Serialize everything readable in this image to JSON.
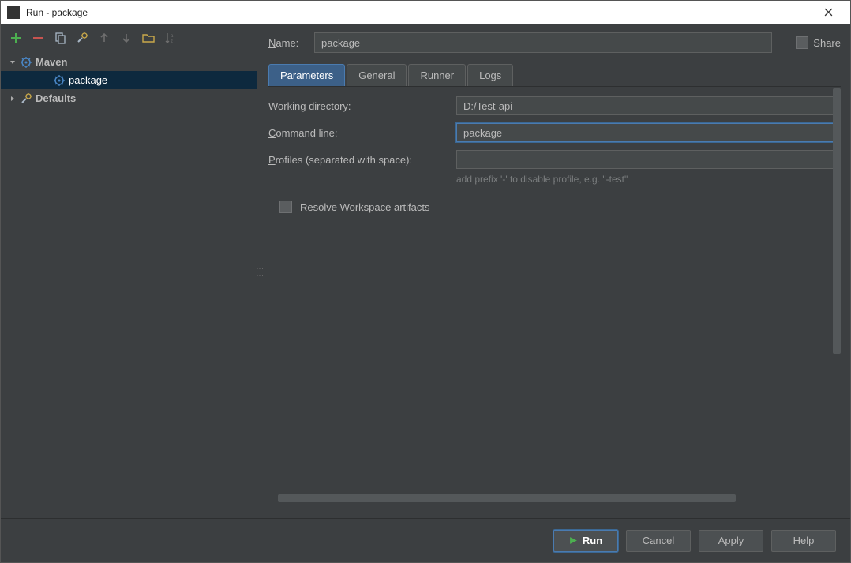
{
  "window": {
    "title": "Run - package"
  },
  "sidebar": {
    "items": [
      {
        "label": "Maven",
        "icon": "gear"
      },
      {
        "label": "package",
        "icon": "gear"
      },
      {
        "label": "Defaults",
        "icon": "wrench-gear"
      }
    ]
  },
  "content": {
    "name_label": "Name:",
    "name_value": "package",
    "share_label": "Share",
    "tabs": [
      {
        "label": "Parameters"
      },
      {
        "label": "General"
      },
      {
        "label": "Runner"
      },
      {
        "label": "Logs"
      }
    ],
    "fields": {
      "working_dir_label_pre": "Working ",
      "working_dir_label_u": "d",
      "working_dir_label_post": "irectory:",
      "working_dir_value": "D:/Test-api",
      "cmd_label_u": "C",
      "cmd_label_post": "ommand line:",
      "cmd_value": "package",
      "profiles_label_u": "P",
      "profiles_label_post": "rofiles (separated with space):",
      "profiles_value": "",
      "profiles_hint": "add prefix '-' to disable profile, e.g. \"-test\"",
      "resolve_label_pre": "Resolve ",
      "resolve_label_u": "W",
      "resolve_label_post": "orkspace artifacts"
    }
  },
  "buttons": {
    "run": "Run",
    "cancel": "Cancel",
    "apply": "Apply",
    "help": "Help"
  }
}
